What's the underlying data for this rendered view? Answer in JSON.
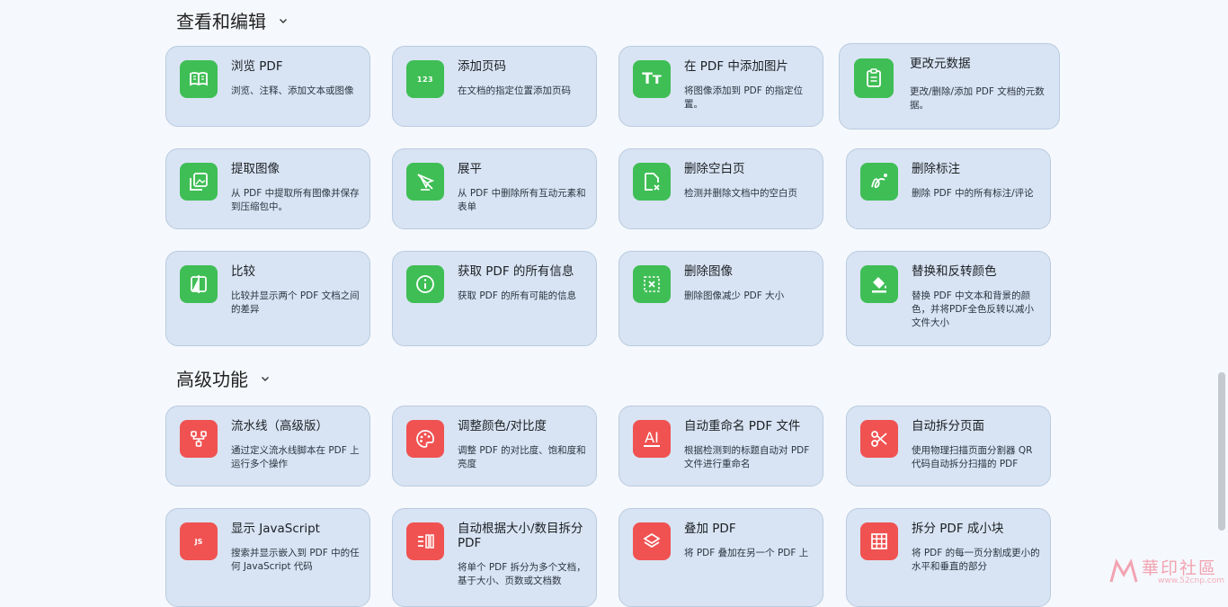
{
  "sections": [
    {
      "title": "查看和编辑"
    },
    {
      "title": "高级功能"
    }
  ],
  "cards": [
    {
      "title": "浏览 PDF",
      "desc": "浏览、注释、添加文本或图像",
      "icon": "book-open-icon"
    },
    {
      "title": "添加页码",
      "desc": "在文档的指定位置添加页码",
      "icon": "page-number-icon",
      "icon_text": "123"
    },
    {
      "title": "在 PDF 中添加图片",
      "desc": "将图像添加到 PDF 的指定位置。",
      "icon": "text-image-icon",
      "icon_text": "Tт"
    },
    {
      "title": "更改元数据",
      "desc": "更改/删除/添加 PDF 文档的元数据。",
      "icon": "clipboard-icon"
    },
    {
      "title": "提取图像",
      "desc": "从 PDF 中提取所有图像并保存到压缩包中。",
      "icon": "image-stack-icon"
    },
    {
      "title": "展平",
      "desc": "从 PDF 中删除所有互动元素和表单",
      "icon": "flatten-icon"
    },
    {
      "title": "删除空白页",
      "desc": "检测并删除文档中的空白页",
      "icon": "blank-page-remove-icon"
    },
    {
      "title": "删除标注",
      "desc": "删除 PDF 中的所有标注/评论",
      "icon": "annotation-remove-icon"
    },
    {
      "title": "比较",
      "desc": "比较并显示两个 PDF 文档之间的差异",
      "icon": "compare-icon"
    },
    {
      "title": "获取 PDF 的所有信息",
      "desc": "获取 PDF 的所有可能的信息",
      "icon": "info-icon"
    },
    {
      "title": "删除图像",
      "desc": "删除图像减少 PDF 大小",
      "icon": "image-remove-icon"
    },
    {
      "title": "替换和反转颜色",
      "desc": "替换 PDF 中文本和背景的颜色，并将PDF全色反转以减小文件大小",
      "icon": "paint-bucket-icon"
    },
    {
      "title": "流水线（高级版）",
      "desc": "通过定义流水线脚本在 PDF 上运行多个操作",
      "icon": "pipeline-icon"
    },
    {
      "title": "调整颜色/对比度",
      "desc": "调整 PDF 的对比度、饱和度和亮度",
      "icon": "palette-icon"
    },
    {
      "title": "自动重命名 PDF 文件",
      "desc": "根据检测到的标题自动对 PDF 文件进行重命名",
      "icon": "ai-rename-icon",
      "icon_text": "AI"
    },
    {
      "title": "自动拆分页面",
      "desc": "使用物理扫描页面分割器 QR 代码自动拆分扫描的 PDF",
      "icon": "scissors-icon"
    },
    {
      "title": "显示 JavaScript",
      "desc": "搜索并显示嵌入到 PDF 中的任何 JavaScript 代码",
      "icon": "javascript-icon",
      "icon_text": "JS"
    },
    {
      "title": "自动根据大小/数目拆分 PDF",
      "desc": "将单个 PDF 拆分为多个文档，基于大小、页数或文档数",
      "icon": "split-size-icon"
    },
    {
      "title": "叠加 PDF",
      "desc": "将 PDF 叠加在另一个 PDF 上",
      "icon": "layers-icon"
    },
    {
      "title": "拆分 PDF 成小块",
      "desc": "将 PDF 的每一页分割成更小的水平和垂直的部分",
      "icon": "grid-icon"
    }
  ],
  "watermark": {
    "text": "華印社區",
    "url": "www.52cnp.com"
  },
  "colors": {
    "green": "#3fbe55",
    "red": "#f05252",
    "card": "#d8e4f3"
  }
}
